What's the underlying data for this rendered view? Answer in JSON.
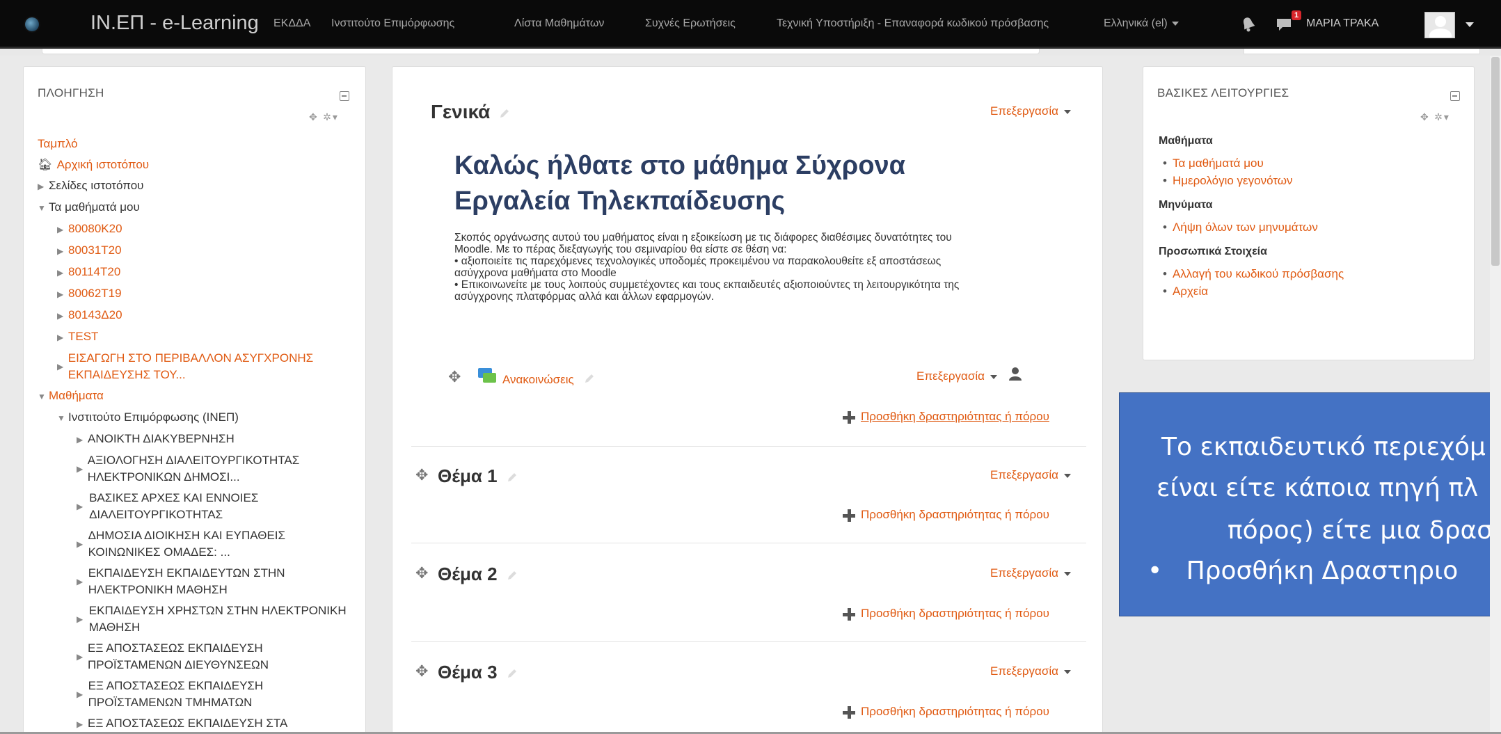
{
  "topbar": {
    "brand": "IN.ΕΠ - e-Learning",
    "nav": [
      {
        "label": "ΕΚΔΔΑ"
      },
      {
        "label": "Ινστιτούτο Επιμόρφωσης"
      },
      {
        "label": "Λίστα Μαθημάτων"
      },
      {
        "label": "Συχνές Ερωτήσεις"
      },
      {
        "label": "Τεχνική Υποστήριξη - Επαναφορά κωδικού πρόσβασης"
      }
    ],
    "language": "Ελληνικά (el)",
    "notification_count": "1",
    "user_name": "ΜΑΡΙΑ ΤΡΑΚΑ"
  },
  "navigation": {
    "title": "ΠΛΟΗΓΗΣΗ",
    "dashboard": "Ταμπλό",
    "home": "Αρχική ιστοτόπου",
    "site_pages": "Σελίδες ιστοτόπου",
    "my_courses": "Τα μαθήματά μου",
    "course_codes": [
      "80080Κ20",
      "80031Τ20",
      "80114Τ20",
      "80062Τ19",
      "80143Δ20",
      "TEST"
    ],
    "long_course": "ΕΙΣΑΓΩΓΗ ΣΤΟ ΠΕΡΙΒΑΛΛΟΝ ΑΣΥΓΧΡΟΝΗΣ ΕΚΠΑΙΔΕΥΣΗΣ ΤΟΥ...",
    "courses": "Μαθήματα",
    "institute": "Ινστιτούτο Επιμόρφωσης (ΙΝΕΠ)",
    "categories": [
      "ΑΝΟΙΚΤΗ ΔΙΑΚΥΒΕΡΝΗΣΗ",
      "ΑΞΙΟΛΟΓΗΣΗ ΔΙΑΛΕΙΤΟΥΡΓΙΚΟΤΗΤΑΣ ΗΛΕΚΤΡΟΝΙΚΩΝ ΔΗΜΟΣΙ...",
      "ΒΑΣΙΚΕΣ ΑΡΧΕΣ ΚΑΙ ΕΝΝΟΙΕΣ ΔΙΑΛΕΙΤΟΥΡΓΙΚΟΤΗΤΑΣ",
      "ΔΗΜΟΣΙΑ ΔΙΟΙΚΗΣΗ ΚΑΙ ΕΥΠΑΘΕΙΣ ΚΟΙΝΩΝΙΚΕΣ ΟΜΑΔΕΣ: ...",
      "ΕΚΠΑΙΔΕΥΣΗ ΕΚΠΑΙΔΕΥΤΩΝ ΣΤΗΝ ΗΛΕΚΤΡΟΝΙΚΗ ΜΑΘΗΣΗ",
      "ΕΚΠΑΙΔΕΥΣΗ ΧΡΗΣΤΩΝ ΣΤΗΝ ΗΛΕΚΤΡΟΝΙΚΗ ΜΑΘΗΣΗ",
      "ΕΞ ΑΠΟΣΤΑΣΕΩΣ ΕΚΠΑΙΔΕΥΣΗ ΠΡΟΪΣΤΑΜΕΝΩΝ ΔΙΕΥΘΥΝΣΕΩΝ",
      "ΕΞ ΑΠΟΣΤΑΣΕΩΣ ΕΚΠΑΙΔΕΥΣΗ ΠΡΟΪΣΤΑΜΕΝΩΝ ΤΜΗΜΑΤΩΝ",
      "ΕΞ ΑΠΟΣΤΑΣΕΩΣ ΕΚΠΑΙΔΕΥΣΗ ΣΤΑ"
    ]
  },
  "main": {
    "general_title": "Γενικά",
    "edit_label": "Επεξεργασία",
    "welcome_line1": "Καλώς ήλθατε στο μάθημα Σύχρονα",
    "welcome_line2": "Εργαλεία Τηλεκπαίδευσης",
    "desc_lines": [
      "Σκοπός οργάνωσης αυτού του μαθήματος είναι η εξοικείωση με τις διάφορες διαθέσιμες δυνατότητες του",
      "Moodle. Με το πέρας διεξαγωγής του σεμιναρίου θα είστε σε θέση να:",
      "• αξιοποιείτε τις παρεχόμενες τεχνολογικές υποδομές προκειμένου να παρακολουθείτε εξ αποστάσεως",
      "ασύγχρονα μαθήματα στο Moodle",
      "• Επικοινωνείτε με τους λοιπούς συμμετέχοντες και τους εκπαιδευτές αξιοποιούντες τη λειτουργικότητα της",
      "ασύγχρονης πλατφόρμας αλλά και άλλων εφαρμογών."
    ],
    "announcements": "Ανακοινώσεις",
    "add_activity": "Προσθήκη δραστηριότητας ή πόρου",
    "topics": [
      "Θέμα 1",
      "Θέμα 2",
      "Θέμα 3"
    ]
  },
  "functions": {
    "title": "ΒΑΣΙΚΕΣ ΛΕΙΤΟΥΡΓΙΕΣ",
    "groups": [
      {
        "heading": "Μαθήματα",
        "items": [
          "Τα μαθήματά μου",
          "Ημερολόγιο γεγονότων"
        ]
      },
      {
        "heading": "Μηνύματα",
        "items": [
          "Λήψη όλων των μηνυμάτων"
        ]
      },
      {
        "heading": "Προσωπικά Στοιχεία",
        "items": [
          "Αλλαγή του κωδικού πρόσβασης",
          "Αρχεία"
        ]
      }
    ]
  },
  "callout": {
    "lines": [
      "Το εκπαιδευτικό περιεχόμ",
      "είναι είτε κάποια πηγή πλ",
      "πόρος) είτε μια δραστ",
      "•   Προσθήκη Δραστηριο"
    ]
  },
  "colors": {
    "link": "#e05a12",
    "topbar": "#0a0a0a",
    "callout": "#4472c4"
  }
}
